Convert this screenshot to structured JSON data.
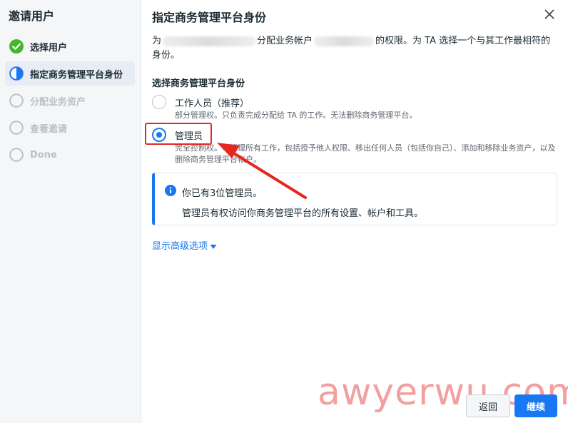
{
  "wizard": {
    "title": "邀请用户",
    "steps": [
      {
        "label": "选择用户",
        "state": "done"
      },
      {
        "label": "指定商务管理平台身份",
        "state": "active"
      },
      {
        "label": "分配业务资产",
        "state": "pending"
      },
      {
        "label": "查看邀请",
        "state": "pending"
      },
      {
        "label": "Done",
        "state": "pending"
      }
    ]
  },
  "dialog": {
    "title": "指定商务管理平台身份",
    "desc_part1": "为",
    "desc_part2": "分配业务帐户",
    "desc_part3": "的权限。为 TA 选择一个与其工作最相符的身份。",
    "section_label": "选择商务管理平台身份",
    "options": [
      {
        "title": "工作人员（推荐）",
        "desc": "部分管理权。只负责完成分配给 TA 的工作。无法删除商务管理平台。",
        "checked": false
      },
      {
        "title": "管理员",
        "desc": "完全控制权。可管理所有工作，包括授予他人权限、移出任何人员（包括你自己）、添加和移除业务资产，以及删除商务管理平台帐户。",
        "checked": true
      }
    ],
    "info_title": "你已有3位管理员。",
    "info_body": "管理员有权访问你商务管理平台的所有设置、帐户和工具。",
    "advanced_link": "显示高级选项",
    "back_label": "返回",
    "next_label": "继续"
  },
  "watermark": "awyerwu.com",
  "colors": {
    "accent": "#1877f2",
    "success": "#42b72a",
    "annotation": "#e5271e"
  },
  "icons": {
    "close": "close-icon",
    "info": "info-icon",
    "caret": "caret-down-icon"
  }
}
